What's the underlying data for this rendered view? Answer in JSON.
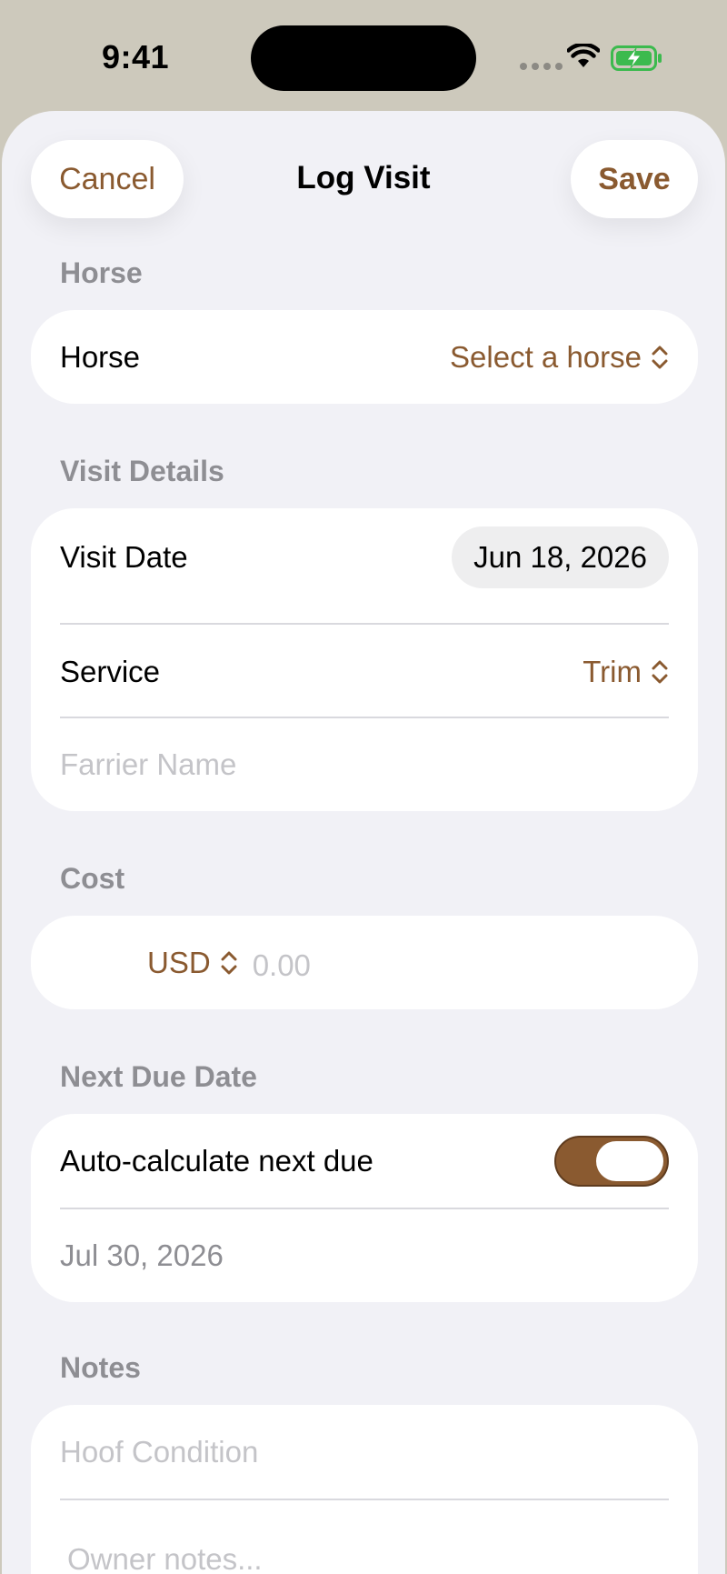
{
  "status": {
    "time": "9:41"
  },
  "nav": {
    "cancel": "Cancel",
    "title": "Log Visit",
    "save": "Save"
  },
  "sections": {
    "horse": {
      "header": "Horse",
      "label": "Horse",
      "value": "Select a horse"
    },
    "visit": {
      "header": "Visit Details",
      "date_label": "Visit Date",
      "date_value": "Jun 18, 2026",
      "service_label": "Service",
      "service_value": "Trim",
      "farrier_placeholder": "Farrier Name"
    },
    "cost": {
      "header": "Cost",
      "currency": "USD",
      "amount_placeholder": "0.00"
    },
    "next_due": {
      "header": "Next Due Date",
      "auto_label": "Auto-calculate next due",
      "auto_enabled": true,
      "date_value": "Jul 30, 2026"
    },
    "notes": {
      "header": "Notes",
      "hoof_placeholder": "Hoof Condition",
      "owner_placeholder": "Owner notes..."
    }
  },
  "colors": {
    "accent": "#8a5a30",
    "background": "#f1f1f6",
    "status_bg": "#cdc9bc"
  }
}
